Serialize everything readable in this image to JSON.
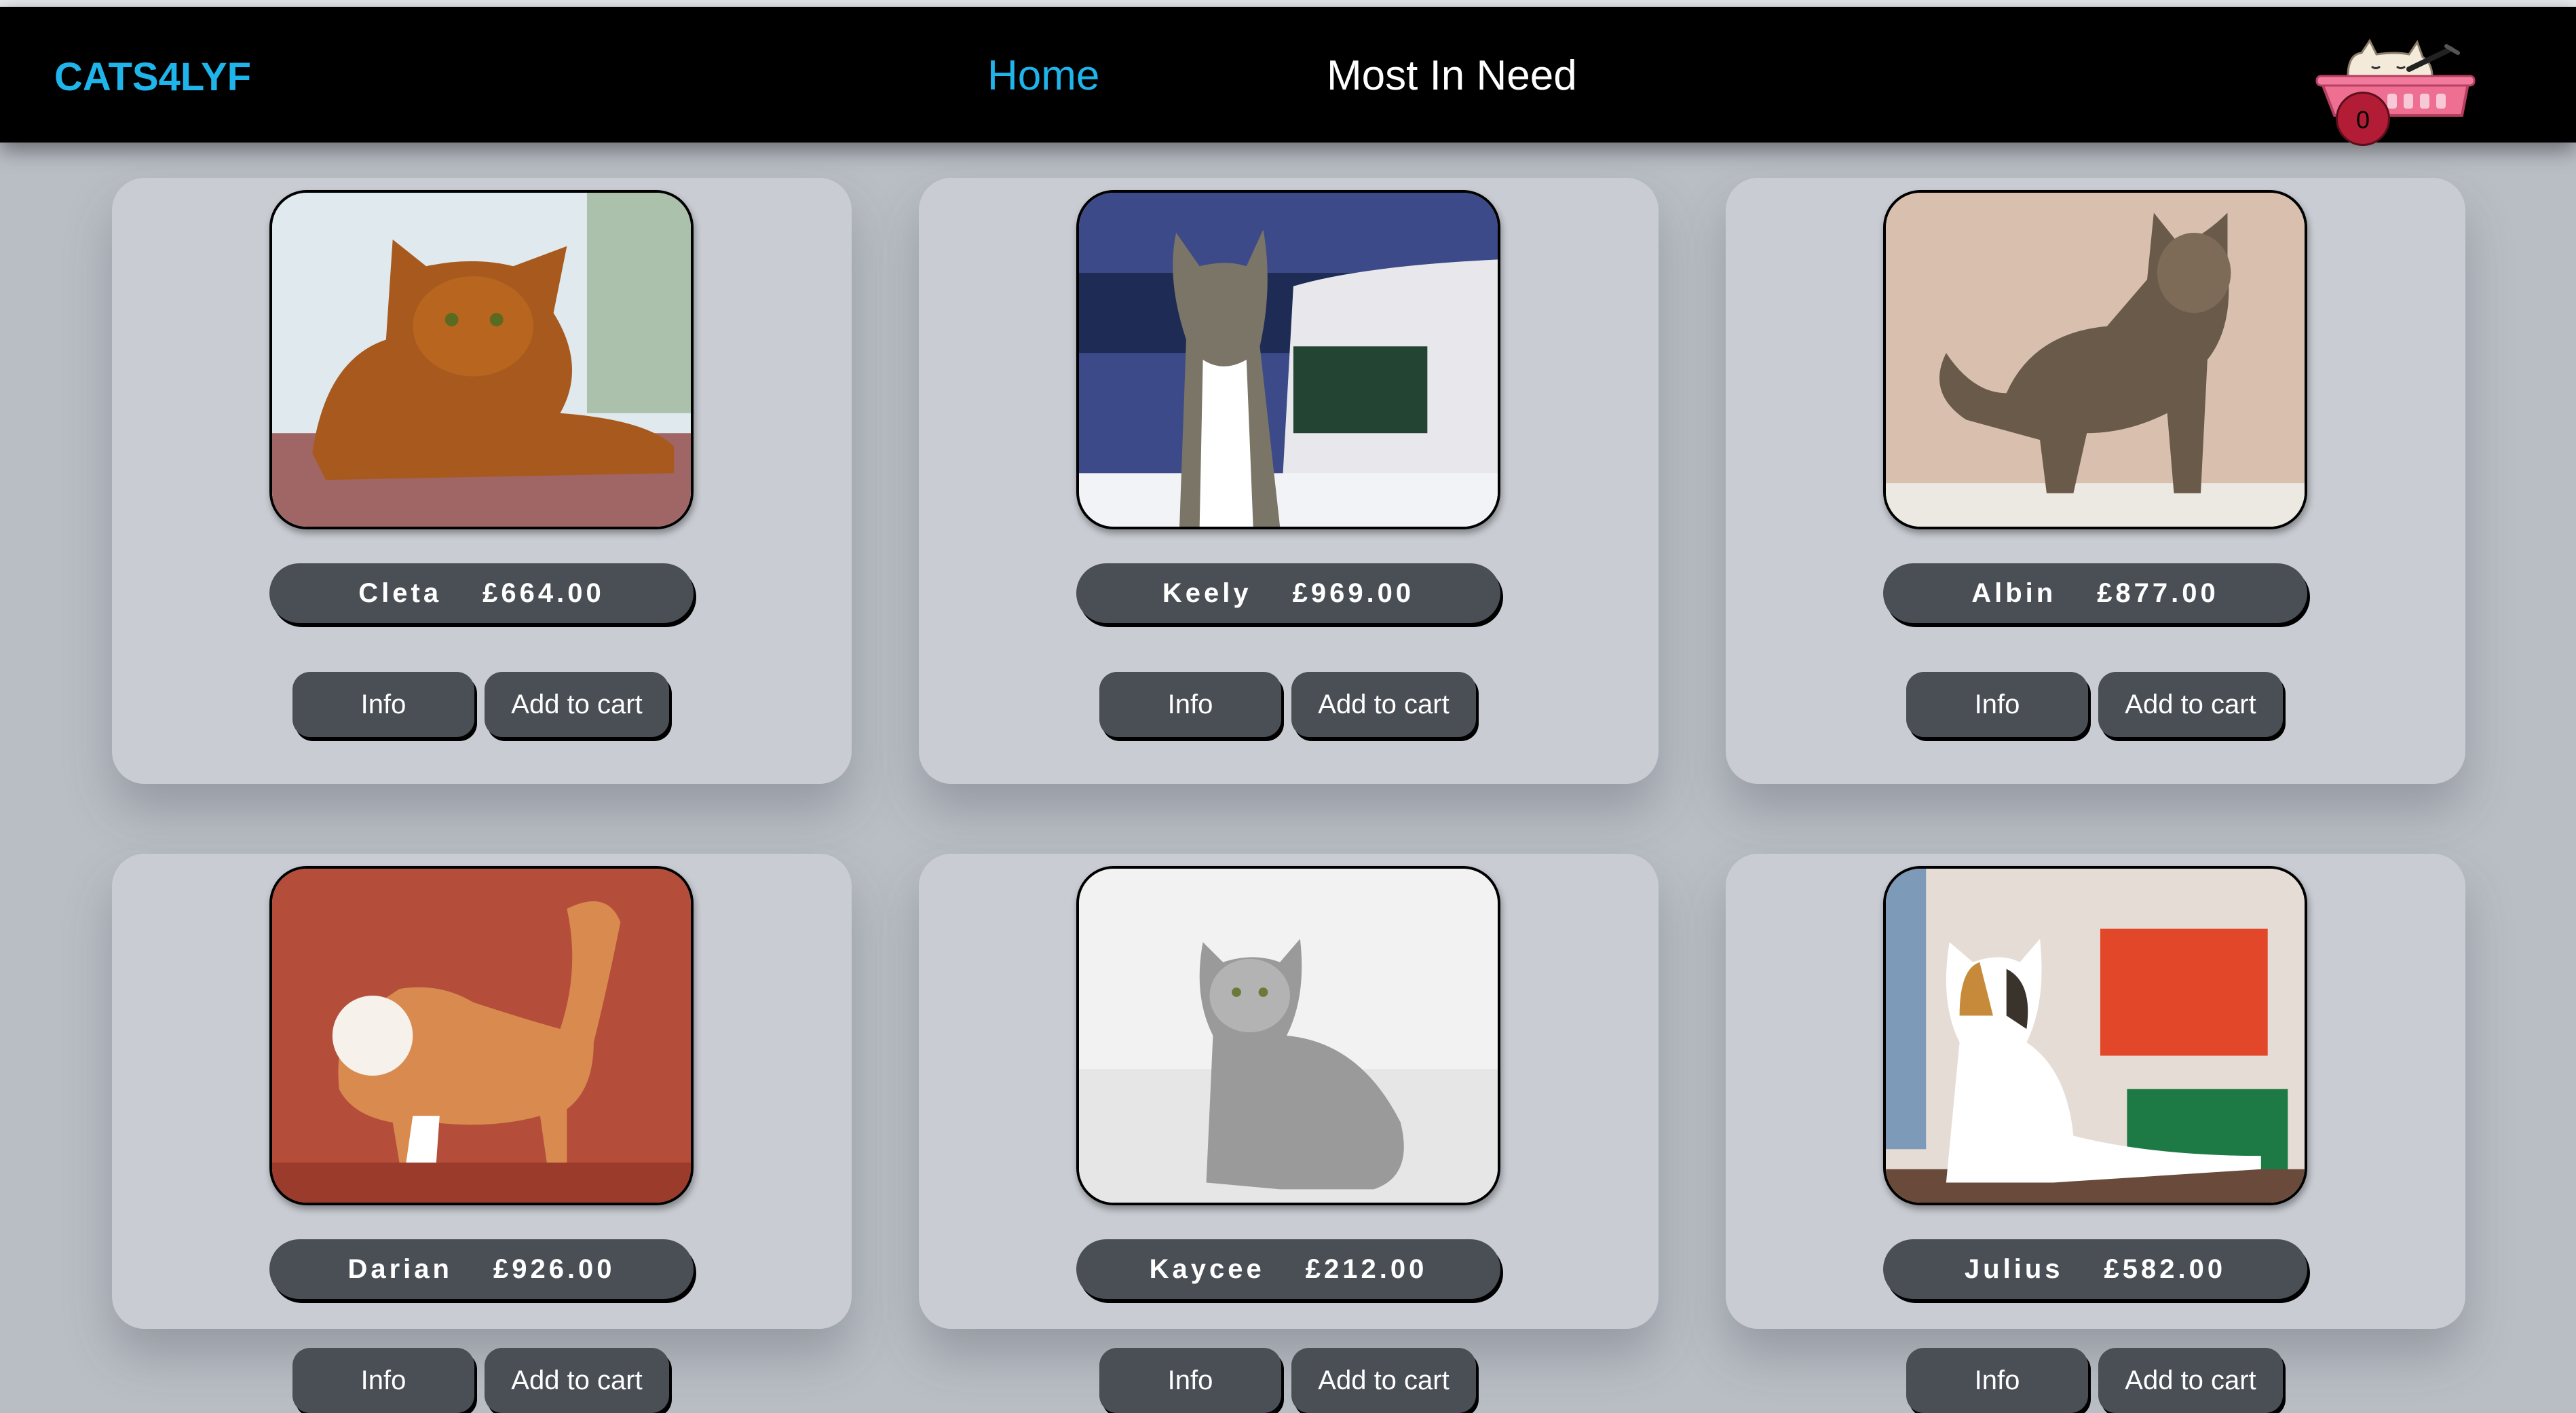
{
  "header": {
    "brand": "CATS4LYF",
    "nav": {
      "home": "Home",
      "most_in_need": "Most In Need"
    },
    "cart_count": "0",
    "colors": {
      "accent": "#1fb4ea",
      "bar": "#000000"
    }
  },
  "cards": [
    {
      "name": "Cleta",
      "price": "£664.00",
      "info_label": "Info",
      "add_label": "Add to cart",
      "photo": "abyssinian-cat-photo"
    },
    {
      "name": "Keely",
      "price": "£969.00",
      "info_label": "Info",
      "add_label": "Add to cart",
      "photo": "tabby-white-cat-seaside-photo"
    },
    {
      "name": "Albin",
      "price": "£877.00",
      "info_label": "Info",
      "add_label": "Add to cart",
      "photo": "maine-coon-cat-photo"
    },
    {
      "name": "Darian",
      "price": "£926.00",
      "info_label": "Info",
      "add_label": "Add to cart",
      "photo": "orange-white-longhair-cat-photo"
    },
    {
      "name": "Kaycee",
      "price": "£212.00",
      "info_label": "Info",
      "add_label": "Add to cart",
      "photo": "silver-tabby-cat-photo"
    },
    {
      "name": "Julius",
      "price": "£582.00",
      "info_label": "Info",
      "add_label": "Add to cart",
      "photo": "calico-cat-photo"
    }
  ]
}
